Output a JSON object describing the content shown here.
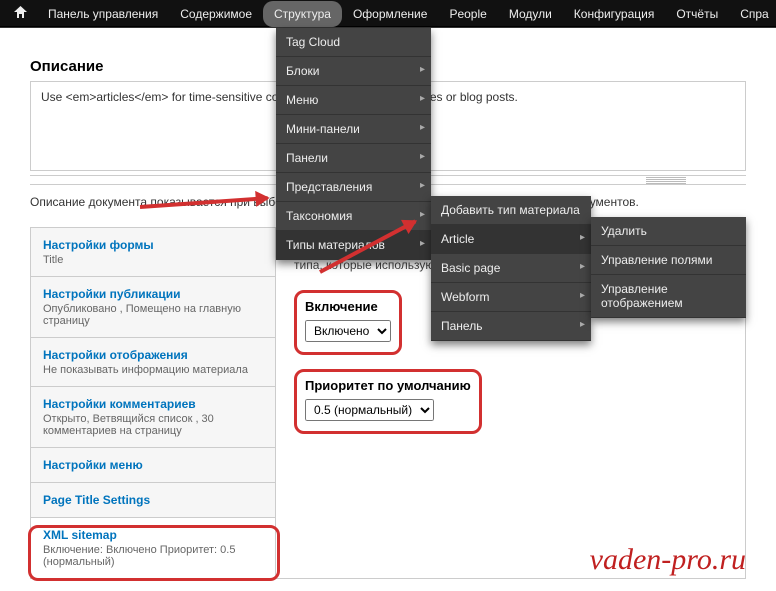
{
  "toolbar": {
    "items": [
      "Панель управления",
      "Содержимое",
      "Структура",
      "Оформление",
      "People",
      "Модули",
      "Конфигурация",
      "Отчёты",
      "Спра"
    ],
    "active_index": 2
  },
  "menu_top": {
    "items": [
      {
        "label": "Tag Cloud",
        "has_sub": false
      },
      {
        "label": "Блоки",
        "has_sub": true
      },
      {
        "label": "Меню",
        "has_sub": true
      },
      {
        "label": "Мини-панели",
        "has_sub": true
      },
      {
        "label": "Панели",
        "has_sub": true
      },
      {
        "label": "Представления",
        "has_sub": true
      },
      {
        "label": "Таксономия",
        "has_sub": true
      },
      {
        "label": "Типы материалов",
        "has_sub": true,
        "hl": true
      }
    ]
  },
  "menu_sub1": {
    "items": [
      {
        "label": "Добавить тип материала",
        "has_sub": false
      },
      {
        "label": "Article",
        "has_sub": true,
        "hl": true
      },
      {
        "label": "Basic page",
        "has_sub": true
      },
      {
        "label": "Webform",
        "has_sub": true
      },
      {
        "label": "Панель",
        "has_sub": true
      }
    ]
  },
  "menu_sub2": {
    "items": [
      {
        "label": "Удалить",
        "has_sub": false
      },
      {
        "label": "Управление полями",
        "has_sub": false
      },
      {
        "label": "Управление отображением",
        "has_sub": false
      }
    ]
  },
  "description_heading": "Описание",
  "description_text": "Use <em>articles</em> for time-sensitive content like news, press releases or blog posts.",
  "description_hint": "Описание документа показывается при выборе типа документа во время создания новых типов документов.",
  "vtabs": [
    {
      "label": "Настройки формы",
      "summary": "Title"
    },
    {
      "label": "Настройки публикации",
      "summary": "Опубликовано , Помещено на главную страницу"
    },
    {
      "label": "Настройки отображения",
      "summary": "Не показывать информацию материала"
    },
    {
      "label": "Настройки комментариев",
      "summary": "Открыто, Ветвящийся список , 30 комментариев на страницу"
    },
    {
      "label": "Настройки меню",
      "summary": ""
    },
    {
      "label": "Page Title Settings",
      "summary": ""
    },
    {
      "label": "XML sitemap",
      "summary": "Включение: Включено\nПриоритет: 0.5 (нормальный)",
      "active": true
    }
  ],
  "pane_intro": "Изменение этой настройки не повлияет на существующие сущности этого типа, которые используют настройки по умолчанию.",
  "fields": {
    "inclusion": {
      "label": "Включение",
      "value": "Включено"
    },
    "priority": {
      "label": "Приоритет по умолчанию",
      "value": "0.5 (нормальный)"
    }
  },
  "watermark": "vaden-pro.ru"
}
